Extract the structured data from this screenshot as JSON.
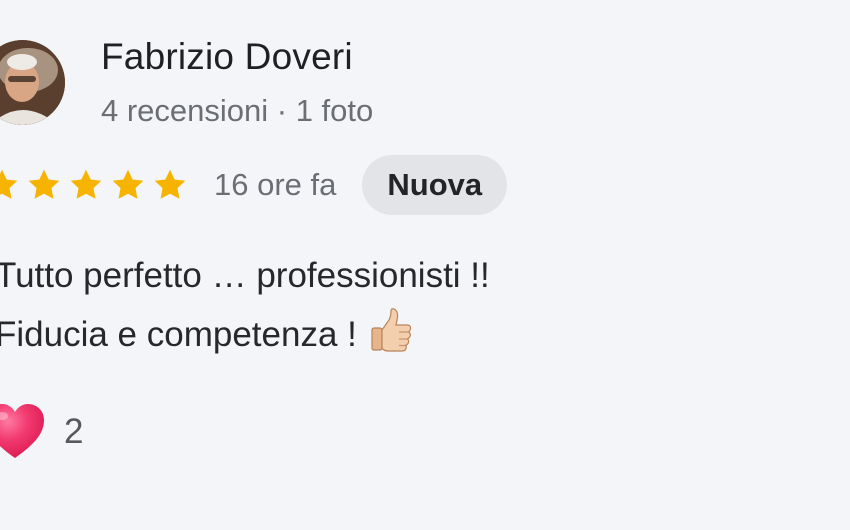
{
  "reviewer": {
    "name": "Fabrizio Doveri",
    "meta": "4 recensioni · 1 foto",
    "avatar_icon": "profile-photo"
  },
  "rating": {
    "stars": 5,
    "max_stars": 5,
    "star_color": "#f6b400",
    "time_ago": "16 ore fa",
    "badge": "Nuova"
  },
  "review": {
    "lines": [
      "Tutto perfetto … professionisti !!",
      "Fiducia e competenza !"
    ],
    "emoji_icon": "thumbs-up-icon"
  },
  "reactions": {
    "icon": "heart-icon",
    "heart_color": "#f0306a",
    "count": "2"
  }
}
